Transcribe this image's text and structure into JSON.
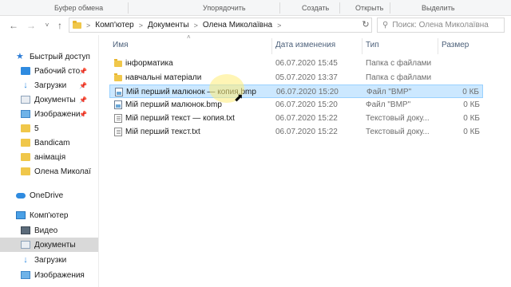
{
  "ribbon": {
    "groups": [
      "Буфер обмена",
      "Упорядочить",
      "Создать",
      "Открыть",
      "Выделить"
    ]
  },
  "address_bar": {
    "crumbs": [
      "Комп'ютер",
      "Документы",
      "Олена Миколаївна"
    ],
    "separator": ">"
  },
  "search": {
    "placeholder": "Поиск: Олена Миколаївна"
  },
  "nav": {
    "quick_access_label": "Быстрый доступ",
    "quick_items": [
      {
        "label": "Рабочий сто",
        "icon": "desktop-icon",
        "pinned": true
      },
      {
        "label": "Загрузки",
        "icon": "download-icon",
        "pinned": true
      },
      {
        "label": "Документы",
        "icon": "documents-icon",
        "pinned": true
      },
      {
        "label": "Изображени",
        "icon": "pictures-icon",
        "pinned": true
      },
      {
        "label": "5",
        "icon": "folder-icon",
        "pinned": false
      },
      {
        "label": "Bandicam",
        "icon": "folder-icon",
        "pinned": false
      },
      {
        "label": "анімація",
        "icon": "folder-icon",
        "pinned": false
      },
      {
        "label": "Олена Миколаї",
        "icon": "folder-icon",
        "pinned": false
      }
    ],
    "onedrive_label": "OneDrive",
    "computer_label": "Комп'ютер",
    "computer_items": [
      {
        "label": "Видео",
        "icon": "video-icon"
      },
      {
        "label": "Документы",
        "icon": "documents-icon",
        "selected": true
      },
      {
        "label": "Загрузки",
        "icon": "download-icon"
      },
      {
        "label": "Изображения",
        "icon": "pictures-icon"
      }
    ]
  },
  "columns": {
    "name": "Имя",
    "date": "Дата изменения",
    "type": "Тип",
    "size": "Размер"
  },
  "files": [
    {
      "name": "інформатика",
      "date": "06.07.2020 15:45",
      "type": "Папка с файлами",
      "size": "",
      "icon": "folder"
    },
    {
      "name": "навчальні матеріали",
      "date": "05.07.2020 13:37",
      "type": "Папка с файлами",
      "size": "",
      "icon": "folder"
    },
    {
      "name": "Мій перший малюнок — копия.bmp",
      "date": "06.07.2020 15:20",
      "type": "Файл \"BMP\"",
      "size": "0 КБ",
      "icon": "bmp",
      "selected": true
    },
    {
      "name": "Мій перший малюнок.bmp",
      "date": "06.07.2020 15:20",
      "type": "Файл \"BMP\"",
      "size": "0 КБ",
      "icon": "bmp"
    },
    {
      "name": "Мій перший текст — копия.txt",
      "date": "06.07.2020 15:22",
      "type": "Текстовый доку...",
      "size": "0 КБ",
      "icon": "txt"
    },
    {
      "name": "Мій перший текст.txt",
      "date": "06.07.2020 15:22",
      "type": "Текстовый доку...",
      "size": "0 КБ",
      "icon": "txt"
    }
  ],
  "colors": {
    "selection_bg": "#cce8ff",
    "selection_border": "#99d1ff",
    "nav_selected": "#d9d9d9",
    "folder": "#f0c74a",
    "header_text": "#4c607a"
  }
}
